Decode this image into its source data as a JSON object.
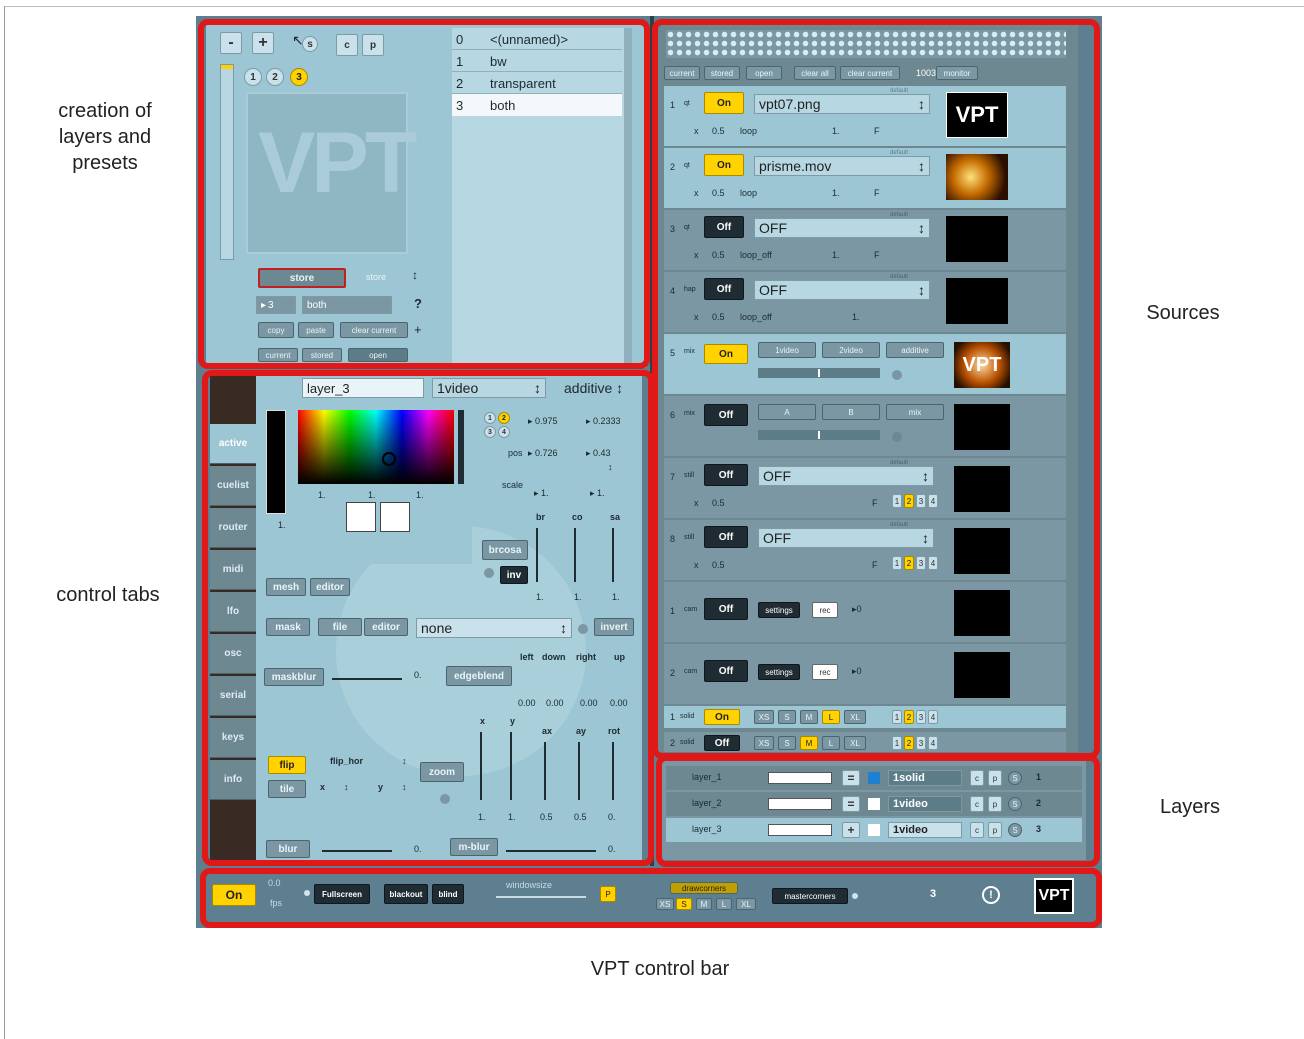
{
  "annotations": {
    "presets": "creation of\nlayers and\npresets",
    "control_tabs": "control tabs",
    "sources": "Sources",
    "layers": "Layers",
    "control_bar": "VPT control bar"
  },
  "presets": {
    "minus": "-",
    "plus": "+",
    "s": "s",
    "c": "c",
    "p": "p",
    "circles": [
      "1",
      "2",
      "3"
    ],
    "logo": "VPT",
    "list": [
      {
        "index": "0",
        "name": "<(unnamed)>"
      },
      {
        "index": "1",
        "name": "bw"
      },
      {
        "index": "2",
        "name": "transparent"
      },
      {
        "index": "3",
        "name": "both"
      }
    ],
    "store_button": "store",
    "store_label": "store",
    "preset_number": "3",
    "preset_name": "both",
    "help": "?",
    "copy": "copy",
    "paste": "paste",
    "clear_current": "clear current",
    "plus_sign": "+",
    "current": "current",
    "stored": "stored",
    "open": "open"
  },
  "tabs": [
    "active",
    "cuelist",
    "router",
    "midi",
    "lfo",
    "osc",
    "serial",
    "keys",
    "info"
  ],
  "layer_controls": {
    "layer_name": "layer_3",
    "source": "1video",
    "blend": "additive",
    "color_vals": [
      "1.",
      "1.",
      "1."
    ],
    "alpha": "1.",
    "circle_nums": [
      "1",
      "2",
      "3",
      "4"
    ],
    "val1": "0.975",
    "val2": "0.2333",
    "pos_label": "pos",
    "pos_x": "0.726",
    "pos_y": "0.43",
    "scale_label": "scale",
    "scale_x": "1.",
    "scale_y": "1.",
    "bcs_labels": [
      "br",
      "co",
      "sa"
    ],
    "brcosa": "brcosa",
    "inv": "inv",
    "bcs_vals": [
      "1.",
      "1.",
      "1."
    ],
    "mesh": "mesh",
    "editor": "editor",
    "mask": "mask",
    "file": "file",
    "editor2": "editor",
    "mask_file": "none",
    "invert": "invert",
    "maskblur": "maskblur",
    "maskblur_val": "0.",
    "edgeblend": "edgeblend",
    "edge_labels": [
      "left",
      "down",
      "right",
      "up"
    ],
    "edge_vals": [
      "0.00",
      "0.00",
      "0.00",
      "0.00"
    ],
    "flip": "flip",
    "tile": "tile",
    "flip_hor": "flip_hor",
    "x": "x",
    "y": "y",
    "zoom": "zoom",
    "xf_labels": [
      "x",
      "y",
      "ax",
      "ay",
      "rot"
    ],
    "xf_vals": [
      "1.",
      "1.",
      "0.5",
      "0.5",
      "0."
    ],
    "blur": "blur",
    "blur_val": "0.",
    "mblur": "m-blur",
    "mblur_val": "0."
  },
  "sources_top": {
    "current": "current",
    "stored": "stored",
    "open": "open",
    "clear_all": "clear all",
    "clear_current": "clear current",
    "count": "1003",
    "monitor": "monitor"
  },
  "sources": [
    {
      "num": "1",
      "type": "qt",
      "state": "On",
      "file": "vpt07.png",
      "x": "x",
      "val": "0.5",
      "loop": "loop",
      "one": "1.",
      "f": "F",
      "default": "default"
    },
    {
      "num": "2",
      "type": "qt",
      "state": "On",
      "file": "prisme.mov",
      "x": "x",
      "val": "0.5",
      "loop": "loop",
      "one": "1.",
      "f": "F",
      "default": "default"
    },
    {
      "num": "3",
      "type": "qt",
      "state": "Off",
      "file": "OFF",
      "x": "x",
      "val": "0.5",
      "loop": "loop_off",
      "one": "1.",
      "f": "F",
      "default": "default"
    },
    {
      "num": "4",
      "type": "hap",
      "state": "Off",
      "file": "OFF",
      "x": "x",
      "val": "0.5",
      "loop": "loop_off",
      "one": "1.",
      "default": "default"
    }
  ],
  "mix_sources": [
    {
      "num": "5",
      "type": "mix",
      "state": "On",
      "b1": "1video",
      "b2": "2video",
      "b3": "additive"
    },
    {
      "num": "6",
      "type": "mix",
      "state": "Off",
      "b1": "A",
      "b2": "B",
      "b3": "mix"
    }
  ],
  "still_sources": [
    {
      "num": "7",
      "type": "still",
      "state": "Off",
      "file": "OFF",
      "x": "x",
      "val": "0.5",
      "f": "F",
      "outs": [
        "1",
        "2",
        "3",
        "4"
      ],
      "default": "default"
    },
    {
      "num": "8",
      "type": "still",
      "state": "Off",
      "file": "OFF",
      "x": "x",
      "val": "0.5",
      "f": "F",
      "outs": [
        "1",
        "2",
        "3",
        "4"
      ],
      "default": "default"
    }
  ],
  "cam_sources": [
    {
      "num": "1",
      "type": "cam",
      "state": "Off",
      "settings": "settings",
      "rec": "rec",
      "val": "0"
    },
    {
      "num": "2",
      "type": "cam",
      "state": "Off",
      "settings": "settings",
      "rec": "rec",
      "val": "0"
    }
  ],
  "solid_sources": [
    {
      "num": "1",
      "type": "solid",
      "state": "On",
      "sizes": [
        "XS",
        "S",
        "M",
        "L",
        "XL"
      ],
      "outs": [
        "1",
        "2",
        "3",
        "4"
      ]
    },
    {
      "num": "2",
      "type": "solid",
      "state": "Off",
      "sizes": [
        "XS",
        "S",
        "M",
        "L",
        "XL"
      ],
      "outs": [
        "1",
        "2",
        "3",
        "4"
      ]
    }
  ],
  "layers": [
    {
      "name": "layer_1",
      "op": "=",
      "source": "1solid",
      "c": "c",
      "p": "p",
      "s": "S",
      "num": "1"
    },
    {
      "name": "layer_2",
      "op": "=",
      "source": "1video",
      "c": "c",
      "p": "p",
      "s": "S",
      "num": "2"
    },
    {
      "name": "layer_3",
      "op": "+",
      "source": "1video",
      "c": "c",
      "p": "p",
      "s": "S",
      "num": "3"
    }
  ],
  "control_bar": {
    "on": "On",
    "fps_top": "0.0",
    "fps": "fps",
    "fullscreen": "Fullscreen",
    "blackout": "blackout",
    "blind": "blind",
    "windowsize": "windowsize",
    "p": "P",
    "drawcorners": "drawcorners",
    "sizes": [
      "XS",
      "S",
      "M",
      "L",
      "XL"
    ],
    "mastercorners": "mastercorners",
    "count": "3",
    "warning": "!",
    "logo": "VPT"
  }
}
